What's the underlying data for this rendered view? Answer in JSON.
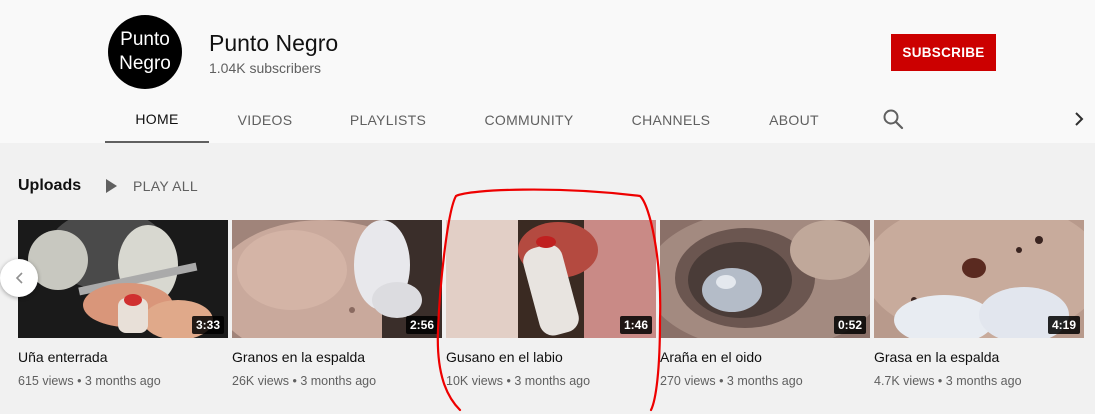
{
  "channel": {
    "avatar_line1": "Punto",
    "avatar_line2": "Negro",
    "name": "Punto Negro",
    "subscribers": "1.04K subscribers",
    "subscribe_label": "SUBSCRIBE"
  },
  "tabs": [
    {
      "label": "HOME",
      "active": true
    },
    {
      "label": "VIDEOS"
    },
    {
      "label": "PLAYLISTS"
    },
    {
      "label": "COMMUNITY"
    },
    {
      "label": "CHANNELS"
    },
    {
      "label": "ABOUT"
    }
  ],
  "uploads": {
    "title": "Uploads",
    "play_all": "PLAY ALL"
  },
  "videos": [
    {
      "title": "Uña enterrada",
      "duration": "3:33",
      "views": "615 views",
      "age": "3 months ago"
    },
    {
      "title": "Granos en la espalda",
      "duration": "2:56",
      "views": "26K views",
      "age": "3 months ago"
    },
    {
      "title": "Gusano en el labio",
      "duration": "1:46",
      "views": "10K views",
      "age": "3 months ago"
    },
    {
      "title": "Araña en el oido",
      "duration": "0:52",
      "views": "270 views",
      "age": "3 months ago"
    },
    {
      "title": "Grasa en la espalda",
      "duration": "4:19",
      "views": "4.7K views",
      "age": "3 months ago"
    }
  ],
  "icons": {
    "search": "search-icon",
    "next": "chevron-right-icon",
    "prev": "chevron-left-icon",
    "play": "play-icon"
  },
  "colors": {
    "subscribe": "#cc0000",
    "annotation": "#ee0000"
  }
}
